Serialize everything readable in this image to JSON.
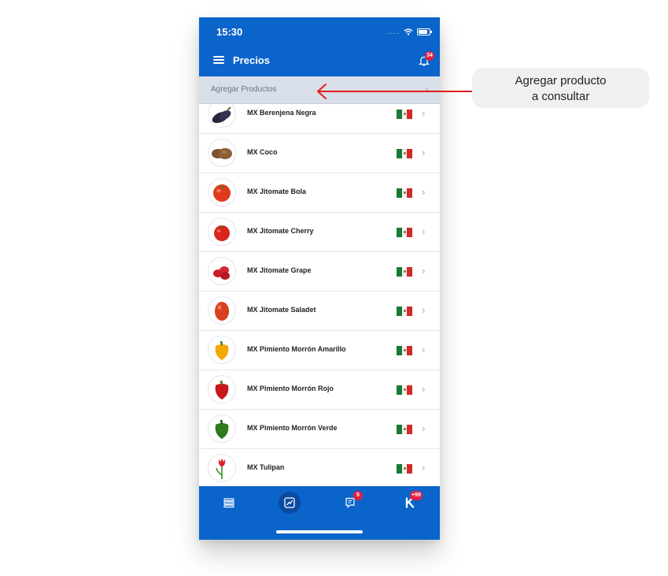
{
  "status_bar": {
    "time": "15:30",
    "signal": "....",
    "icons": [
      "wifi-icon",
      "battery-icon"
    ]
  },
  "header": {
    "title": "Precios",
    "notification_badge": "34"
  },
  "add_bar": {
    "label": "Agregar Productos",
    "chevron": "›"
  },
  "products": [
    {
      "name": "MX Berenjena Negra",
      "icon": "eggplant",
      "flag": "mexico-flag",
      "chevron": "›"
    },
    {
      "name": "MX Coco",
      "icon": "coconut",
      "flag": "mexico-flag",
      "chevron": "›"
    },
    {
      "name": "MX Jitomate Bola",
      "icon": "tomato",
      "flag": "mexico-flag",
      "chevron": "›"
    },
    {
      "name": "MX Jitomate Cherry",
      "icon": "cherry-tomato",
      "flag": "mexico-flag",
      "chevron": "›"
    },
    {
      "name": "MX Jitomate Grape",
      "icon": "grape-tomato",
      "flag": "mexico-flag",
      "chevron": "›"
    },
    {
      "name": "MX Jitomate Saladet",
      "icon": "saladet-tomato",
      "flag": "mexico-flag",
      "chevron": "›"
    },
    {
      "name": "MX Pimiento Morrón Amarillo",
      "icon": "yellow-pepper",
      "flag": "mexico-flag",
      "chevron": "›"
    },
    {
      "name": "MX Pimiento Morrón Rojo",
      "icon": "red-pepper",
      "flag": "mexico-flag",
      "chevron": "›"
    },
    {
      "name": "MX Pimiento Morrón Verde",
      "icon": "green-pepper",
      "flag": "mexico-flag",
      "chevron": "›"
    },
    {
      "name": "MX Tulipan",
      "icon": "tulip",
      "flag": "mexico-flag",
      "chevron": "›"
    }
  ],
  "tabbar": {
    "tabs": [
      {
        "name": "list-icon",
        "badge": ""
      },
      {
        "name": "prices-chart-icon",
        "badge": "",
        "active": true
      },
      {
        "name": "messages-icon",
        "badge": "5"
      },
      {
        "name": "k-logo-icon",
        "badge": "+99"
      }
    ]
  },
  "callout": {
    "line1": "Agregar producto",
    "line2": "a consultar"
  },
  "colors": {
    "primary": "#0a64c9",
    "badge": "#e02045",
    "arrow": "#e21d1d",
    "add_bar": "#d8dfe8"
  }
}
